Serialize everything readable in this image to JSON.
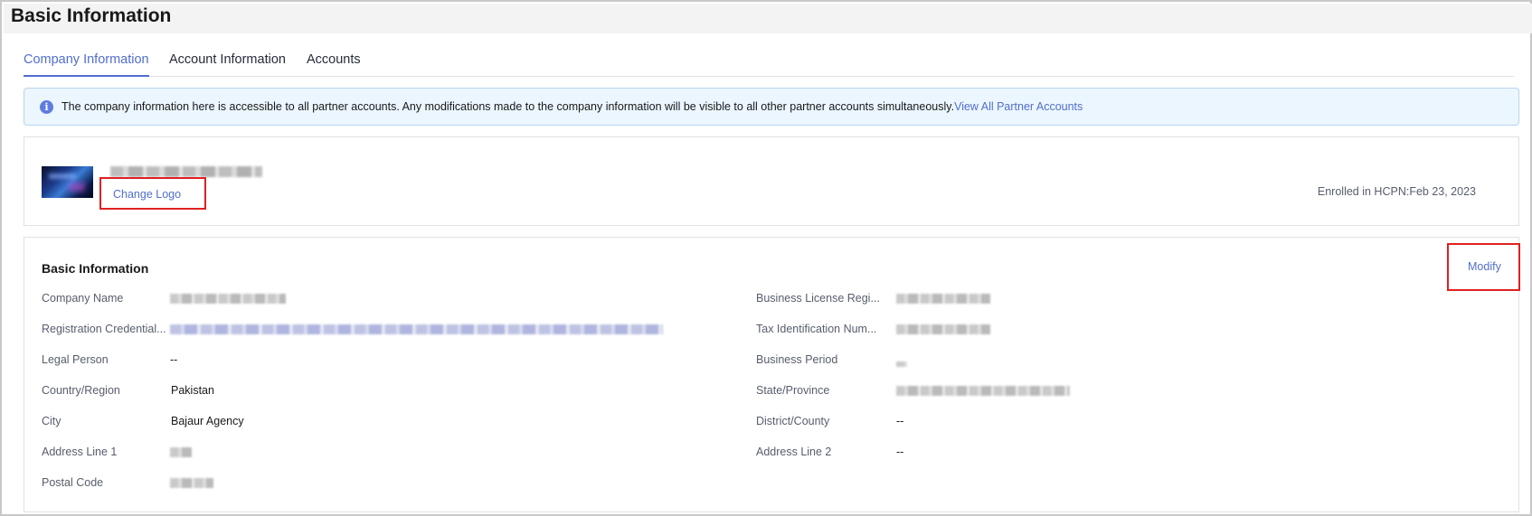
{
  "page": {
    "title": "Basic Information"
  },
  "tabs": [
    {
      "label": "Company Information",
      "active": true
    },
    {
      "label": "Account Information",
      "active": false
    },
    {
      "label": "Accounts",
      "active": false
    }
  ],
  "notice": {
    "icon": "info-icon",
    "text": "The company information here is accessible to all partner accounts. Any modifications made to the company information will be visible to all other partner accounts simultaneously.",
    "link": "View All Partner Accounts"
  },
  "logo_card": {
    "change_logo": "Change Logo",
    "enrolled": "Enrolled in HCPN:Feb 23, 2023"
  },
  "basic_info": {
    "title": "Basic Information",
    "modify": "Modify",
    "left": [
      {
        "label": "Company Name",
        "value": ""
      },
      {
        "label": "Registration Credential...",
        "value": ""
      },
      {
        "label": "Legal Person",
        "value": "--"
      },
      {
        "label": "Country/Region",
        "value": "Pakistan"
      },
      {
        "label": "City",
        "value": "Bajaur Agency"
      },
      {
        "label": "Address Line 1",
        "value": ""
      },
      {
        "label": "Postal Code",
        "value": ""
      }
    ],
    "right": [
      {
        "label": "Business License Regi...",
        "value": ""
      },
      {
        "label": "Tax Identification Num...",
        "value": ""
      },
      {
        "label": "Business Period",
        "value": ""
      },
      {
        "label": "State/Province",
        "value": ""
      },
      {
        "label": "District/County",
        "value": "--"
      },
      {
        "label": "Address Line 2",
        "value": "--"
      }
    ]
  },
  "colors": {
    "accent": "#526ecc",
    "highlight_border": "#e02020",
    "notice_bg": "#ebf6ff"
  }
}
